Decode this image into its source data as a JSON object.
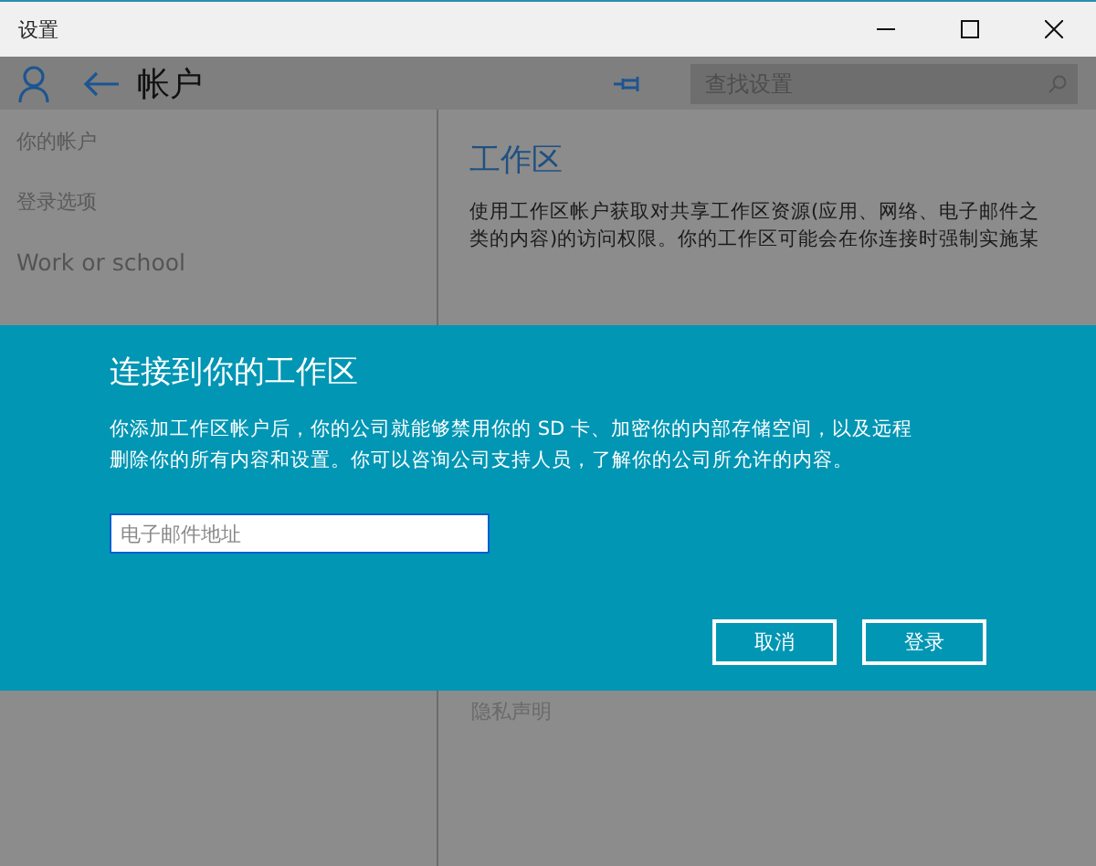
{
  "window": {
    "title": "设置"
  },
  "header": {
    "title": "帐户",
    "search": {
      "placeholder": "查找设置"
    }
  },
  "sidebar": {
    "items": [
      {
        "label": "你的帐户",
        "selected": false
      },
      {
        "label": "登录选项",
        "selected": false
      },
      {
        "label": "Work or school",
        "selected": true
      }
    ]
  },
  "content": {
    "title": "工作区",
    "description": "使用工作区帐户获取对共享工作区资源(应用、网络、电子邮件之类的内容)的访问权限。你的工作区可能会在你连接时强制实施某",
    "links": [
      "隐私声明"
    ]
  },
  "dialog": {
    "title": "连接到你的工作区",
    "message": "你添加工作区帐户后，你的公司就能够禁用你的 SD 卡、加密你的内部存储空间，以及远程删除你的所有内容和设置。你可以咨询公司支持人员，了解你的公司所允许的内容。",
    "email": {
      "placeholder": "电子邮件地址"
    },
    "buttons": [
      "取消",
      "登录"
    ]
  }
}
